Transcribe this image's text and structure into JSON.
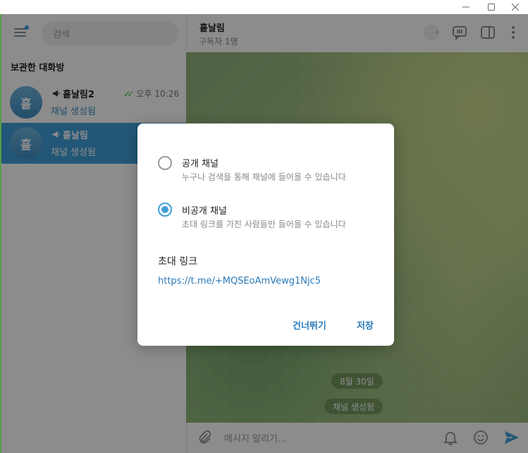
{
  "search": {
    "placeholder": "검색"
  },
  "sidebar": {
    "section_title": "보관한 대화방",
    "chats": [
      {
        "avatar": "흩",
        "name": "흩날림2",
        "time": "오후 10:26",
        "preview": "채널 생성됨"
      },
      {
        "avatar": "흩",
        "name": "흩날림",
        "time": "",
        "preview": "채널 생성됨"
      }
    ]
  },
  "header": {
    "title": "흩날림",
    "subtitle": "구독자 1명"
  },
  "chat": {
    "date": "8월 30일",
    "service_message": "채널 생성됨"
  },
  "composer": {
    "placeholder": "메시지 알리기..."
  },
  "dialog": {
    "options": [
      {
        "title": "공개 채널",
        "description": "누구나 검색을 통해 채널에 들어올 수 있습니다",
        "selected": false
      },
      {
        "title": "비공개 채널",
        "description": "초대 링크를 가진 사람들만 들어올 수 있습니다",
        "selected": true
      }
    ],
    "invite_title": "초대 링크",
    "invite_link": "https://t.me/+MQSEoAmVewg1Njc5",
    "skip_label": "건너뛰기",
    "save_label": "저장"
  },
  "colors": {
    "accent": "#419fd9",
    "link": "#2a7ab9",
    "check": "#4bb34b"
  }
}
